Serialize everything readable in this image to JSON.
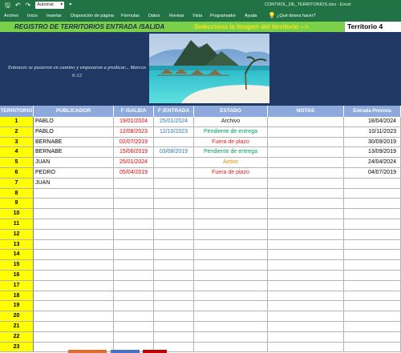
{
  "titlebar": {
    "autosave": "Automát",
    "filename": "CONTROL_DE_TERRITORIOS.xlsx  -  Excel"
  },
  "ribbon": {
    "tabs": [
      "Archivo",
      "Inicio",
      "Insertar",
      "Disposición de página",
      "Fórmulas",
      "Datos",
      "Revisar",
      "Vista",
      "Programador",
      "Ayuda"
    ],
    "help_search": "¿Qué desea hacer?"
  },
  "banner": {
    "title": "REGISTRO DE TERRITORIOS ENTRADA /SALIDA",
    "hint": "Selecciona la imagen del territorio -->",
    "territory": "Territorio 4"
  },
  "quote": {
    "text": "Entonces se pusieron en camino y empezaron a predicar...     Marcos 6:12"
  },
  "colors": {
    "ribbon": "#217346",
    "banner": "#7bd04a",
    "info_bg": "#1f3864",
    "header_bg": "#8ea9db",
    "number_bg": "#ffff00"
  },
  "headers": [
    "TERRITORIO",
    "PUBLICADOR",
    "F /SALIDA",
    "F /ENTRADA",
    "ESTADO",
    "NOTAS",
    "Entrada Prevista"
  ],
  "rows": [
    {
      "num": "1",
      "pub": "PABLO",
      "salida": "19/01/2024",
      "entrada": "25/01/2024",
      "estado": "Archivo",
      "st": "archivo",
      "notas": "",
      "prevista": "18/04/2024"
    },
    {
      "num": "2",
      "pub": "PABLO",
      "salida": "12/08/2023",
      "entrada": "12/10/2023",
      "estado": "Pendiente de entrega",
      "st": "pendiente",
      "notas": "",
      "prevista": "10/11/2023"
    },
    {
      "num": "3",
      "pub": "BERNABE",
      "salida": "02/07/2019",
      "entrada": "",
      "estado": "Fuera de plazo",
      "st": "fuera",
      "notas": "",
      "prevista": "30/09/2019"
    },
    {
      "num": "4",
      "pub": "BERNABE",
      "salida": "15/06/2019",
      "entrada": "03/08/2019",
      "estado": "Pendiente de entrega",
      "st": "pendiente",
      "notas": "",
      "prevista": "13/09/2019"
    },
    {
      "num": "5",
      "pub": "JUAN",
      "salida": "25/01/2024",
      "entrada": "",
      "estado": "Activo",
      "st": "activo",
      "notas": "",
      "prevista": "24/04/2024"
    },
    {
      "num": "6",
      "pub": "PEDRO",
      "salida": "05/04/2019",
      "entrada": "",
      "estado": "Fuera de plazo",
      "st": "fuera",
      "notas": "",
      "prevista": "04/07/2019"
    },
    {
      "num": "7",
      "pub": "JUAN",
      "salida": "",
      "entrada": "",
      "estado": "",
      "st": "",
      "notas": "",
      "prevista": ""
    },
    {
      "num": "8",
      "pub": "",
      "salida": "",
      "entrada": "",
      "estado": "",
      "st": "",
      "notas": "",
      "prevista": ""
    },
    {
      "num": "9",
      "pub": "",
      "salida": "",
      "entrada": "",
      "estado": "",
      "st": "",
      "notas": "",
      "prevista": ""
    },
    {
      "num": "10",
      "pub": "",
      "salida": "",
      "entrada": "",
      "estado": "",
      "st": "",
      "notas": "",
      "prevista": ""
    },
    {
      "num": "11",
      "pub": "",
      "salida": "",
      "entrada": "",
      "estado": "",
      "st": "",
      "notas": "",
      "prevista": ""
    },
    {
      "num": "12",
      "pub": "",
      "salida": "",
      "entrada": "",
      "estado": "",
      "st": "",
      "notas": "",
      "prevista": ""
    },
    {
      "num": "13",
      "pub": "",
      "salida": "",
      "entrada": "",
      "estado": "",
      "st": "",
      "notas": "",
      "prevista": ""
    },
    {
      "num": "14",
      "pub": "",
      "salida": "",
      "entrada": "",
      "estado": "",
      "st": "",
      "notas": "",
      "prevista": ""
    },
    {
      "num": "15",
      "pub": "",
      "salida": "",
      "entrada": "",
      "estado": "",
      "st": "",
      "notas": "",
      "prevista": ""
    },
    {
      "num": "16",
      "pub": "",
      "salida": "",
      "entrada": "",
      "estado": "",
      "st": "",
      "notas": "",
      "prevista": ""
    },
    {
      "num": "17",
      "pub": "",
      "salida": "",
      "entrada": "",
      "estado": "",
      "st": "",
      "notas": "",
      "prevista": ""
    },
    {
      "num": "18",
      "pub": "",
      "salida": "",
      "entrada": "",
      "estado": "",
      "st": "",
      "notas": "",
      "prevista": ""
    },
    {
      "num": "19",
      "pub": "",
      "salida": "",
      "entrada": "",
      "estado": "",
      "st": "",
      "notas": "",
      "prevista": ""
    },
    {
      "num": "20",
      "pub": "",
      "salida": "",
      "entrada": "",
      "estado": "",
      "st": "",
      "notas": "",
      "prevista": ""
    },
    {
      "num": "21",
      "pub": "",
      "salida": "",
      "entrada": "",
      "estado": "",
      "st": "",
      "notas": "",
      "prevista": ""
    },
    {
      "num": "22",
      "pub": "",
      "salida": "",
      "entrada": "",
      "estado": "",
      "st": "",
      "notas": "",
      "prevista": ""
    },
    {
      "num": "23",
      "pub": "",
      "salida": "",
      "entrada": "",
      "estado": "",
      "st": "",
      "notas": "",
      "prevista": ""
    }
  ],
  "icons": {
    "save": "save-icon",
    "undo": "undo-icon",
    "redo": "redo-icon",
    "help": "lightbulb-icon"
  }
}
